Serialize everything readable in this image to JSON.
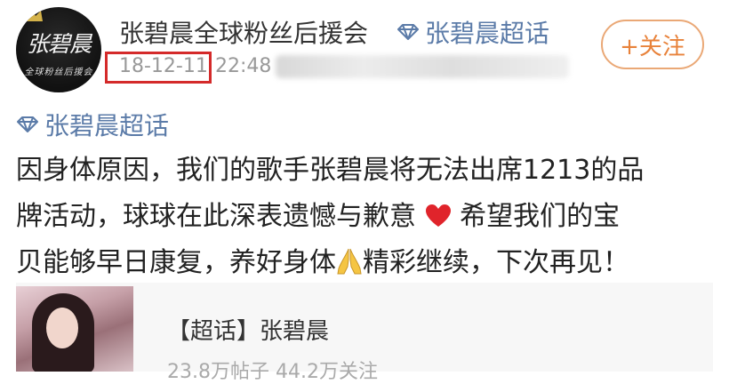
{
  "post": {
    "username": "张碧晨全球粉丝后援会",
    "header_topic": "张碧晨超话",
    "follow_label": "+关注",
    "date": "18-12-11",
    "time": "22:48",
    "body_topic": "张碧晨超话",
    "text": {
      "line1": "因身体原因，我们的歌手张碧晨将无法出席1213的品",
      "line2_a": "牌活动，球球在此深表遗憾与歉意 ",
      "line2_b": " 希望我们的宝",
      "line3_a": "贝能够早日康复，养好身体",
      "line3_b": "精彩继续，下次再见！"
    },
    "avatar": {
      "logo_text": "张碧晨",
      "logo_subtext": "全球粉丝后援会"
    }
  },
  "card": {
    "title": "【超话】张碧晨",
    "stats": "23.8万帖子 44.2万关注"
  },
  "colors": {
    "topic": "#5b7ba8",
    "follow": "#e8823a",
    "highlight_box": "#d42a2a",
    "heart": "#e0242b"
  },
  "icons": {
    "topic": "diamond-icon",
    "heart": "heart-icon",
    "pray": "folded-hands-icon"
  }
}
